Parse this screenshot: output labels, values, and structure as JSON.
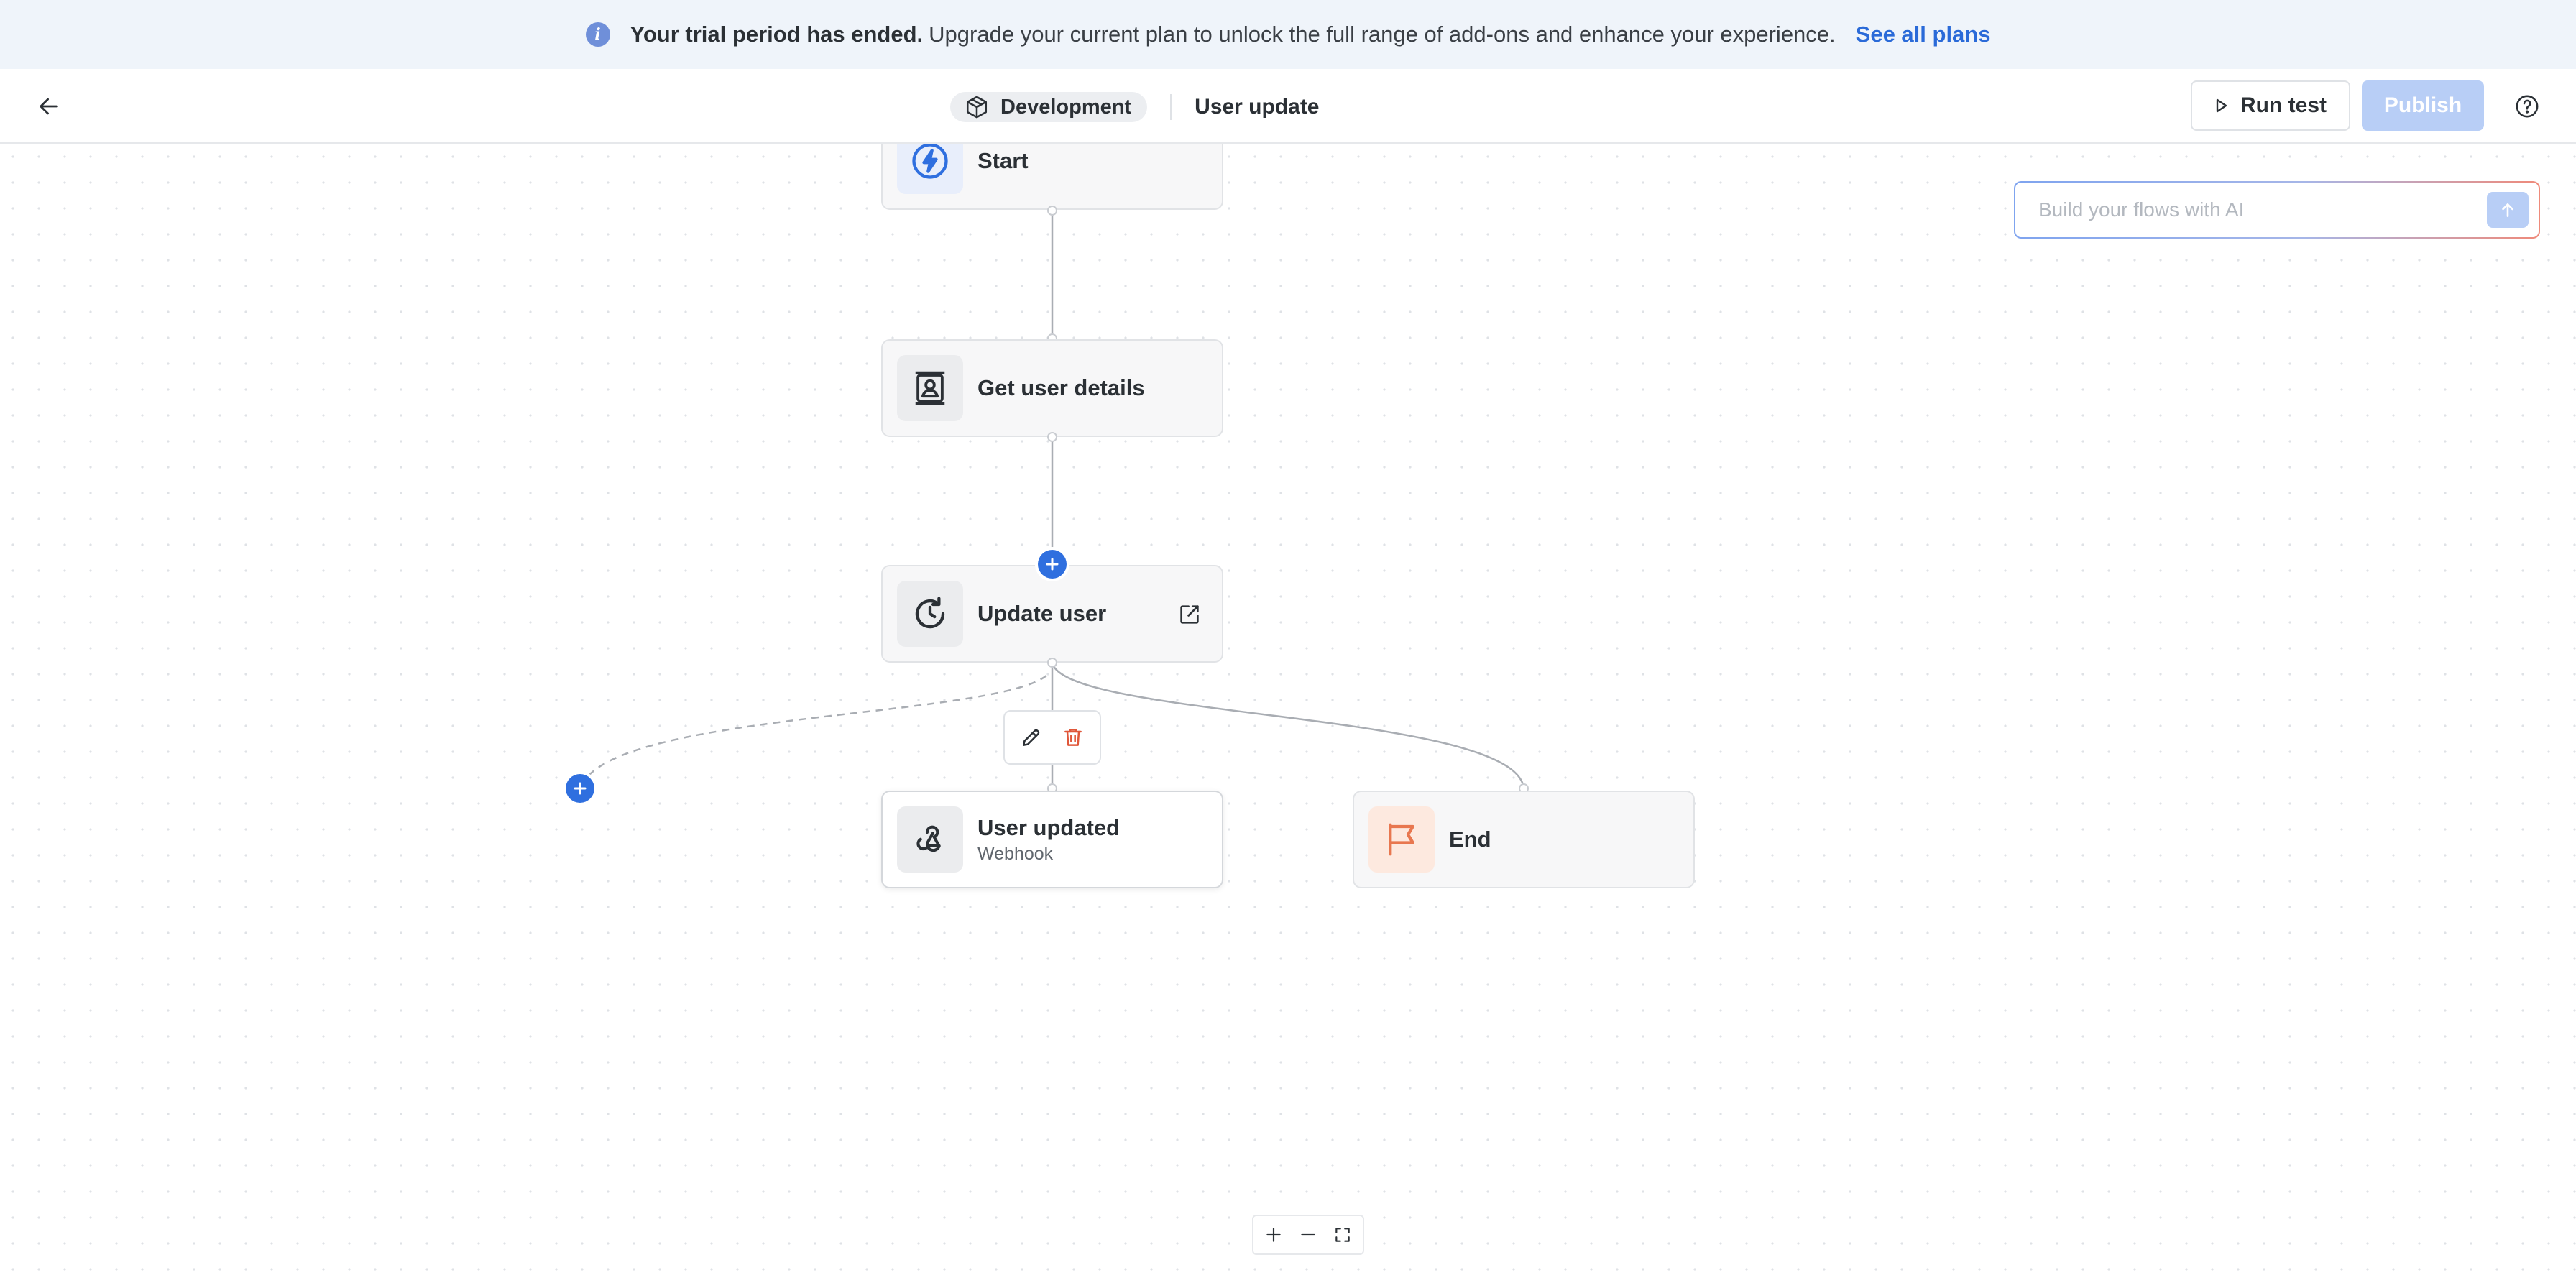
{
  "banner": {
    "strong_text": "Your trial period has ended.",
    "text": "Upgrade your current plan to unlock the full range of add-ons and enhance your experience.",
    "link": "See all plans"
  },
  "header": {
    "environment": "Development",
    "flow_name": "User update",
    "run_test_label": "Run test",
    "publish_label": "Publish"
  },
  "ai_prompt": {
    "placeholder": "Build your flows with AI"
  },
  "nodes": {
    "start": {
      "title": "Start",
      "icon": "lightning-icon"
    },
    "get_user_details": {
      "title": "Get user details",
      "icon": "contact-card-icon"
    },
    "update_user": {
      "title": "Update user",
      "icon": "refresh-icon"
    },
    "user_updated": {
      "title": "User updated",
      "subtitle": "Webhook",
      "icon": "webhook-icon"
    },
    "end": {
      "title": "End",
      "icon": "flag-icon"
    }
  },
  "colors": {
    "accent": "#2f6fdf",
    "publish_disabled": "#b8cef6",
    "end_icon": "#e8774f",
    "delete_icon": "#e0573a"
  }
}
